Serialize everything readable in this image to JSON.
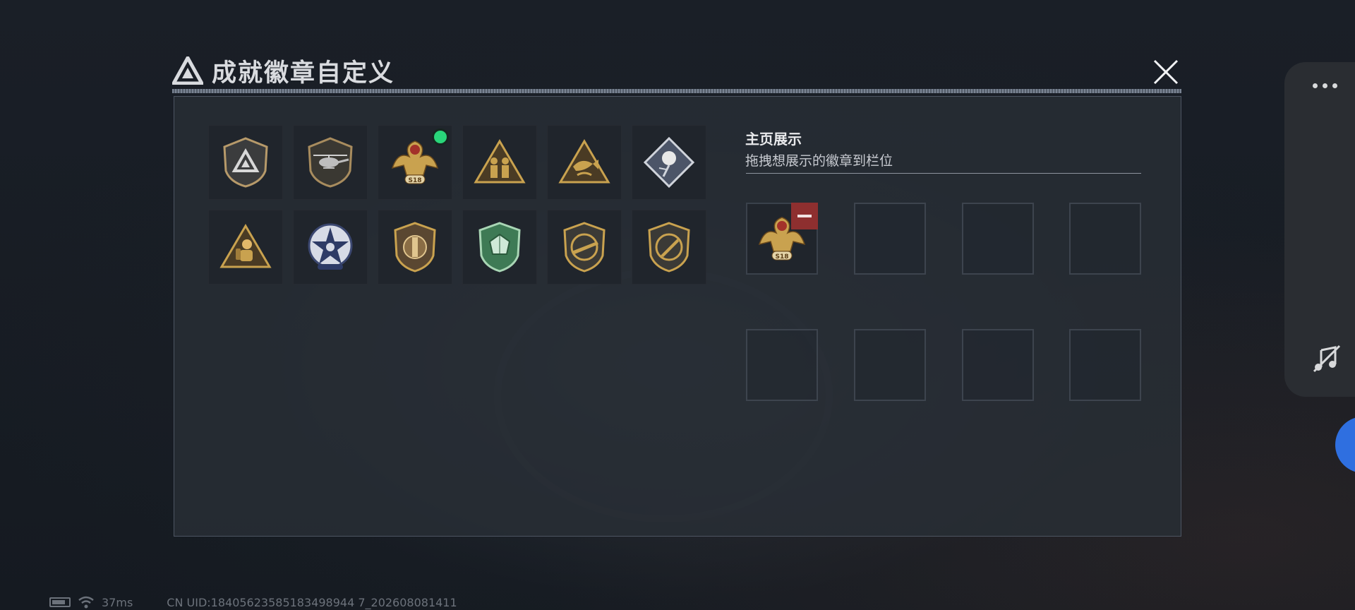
{
  "window": {
    "title": "成就徽章自定义"
  },
  "badges": [
    {
      "name": "delta-triangle-shield",
      "new": false
    },
    {
      "name": "helicopter-shield",
      "new": false
    },
    {
      "name": "golden-eagle-s18",
      "new": true
    },
    {
      "name": "soldiers-triangle",
      "new": false
    },
    {
      "name": "fish-triangle",
      "new": false
    },
    {
      "name": "rose-diamond",
      "new": false
    },
    {
      "name": "diver-triangle",
      "new": false
    },
    {
      "name": "star-wings-round",
      "new": false
    },
    {
      "name": "bronze-emblem-shield",
      "new": false
    },
    {
      "name": "green-gem-shield",
      "new": false
    },
    {
      "name": "rifle-shield",
      "new": false
    },
    {
      "name": "knife-shield",
      "new": false
    }
  ],
  "showcase": {
    "title": "主页展示",
    "subtitle": "拖拽想展示的徽章到栏位",
    "slots": [
      {
        "badge": "golden-eagle-s18"
      },
      {
        "badge": null
      },
      {
        "badge": null
      },
      {
        "badge": null
      },
      {
        "badge": null
      },
      {
        "badge": null
      },
      {
        "badge": null
      },
      {
        "badge": null
      }
    ]
  },
  "badge_text": {
    "season_tag": "S18"
  },
  "status_bar": {
    "ping": "37ms",
    "uid": "CN UID:18405623585183498944 7_202608081411"
  },
  "colors": {
    "gold": "#c9a24f",
    "new_dot": "#29d67a",
    "remove": "#8e2f2f"
  }
}
